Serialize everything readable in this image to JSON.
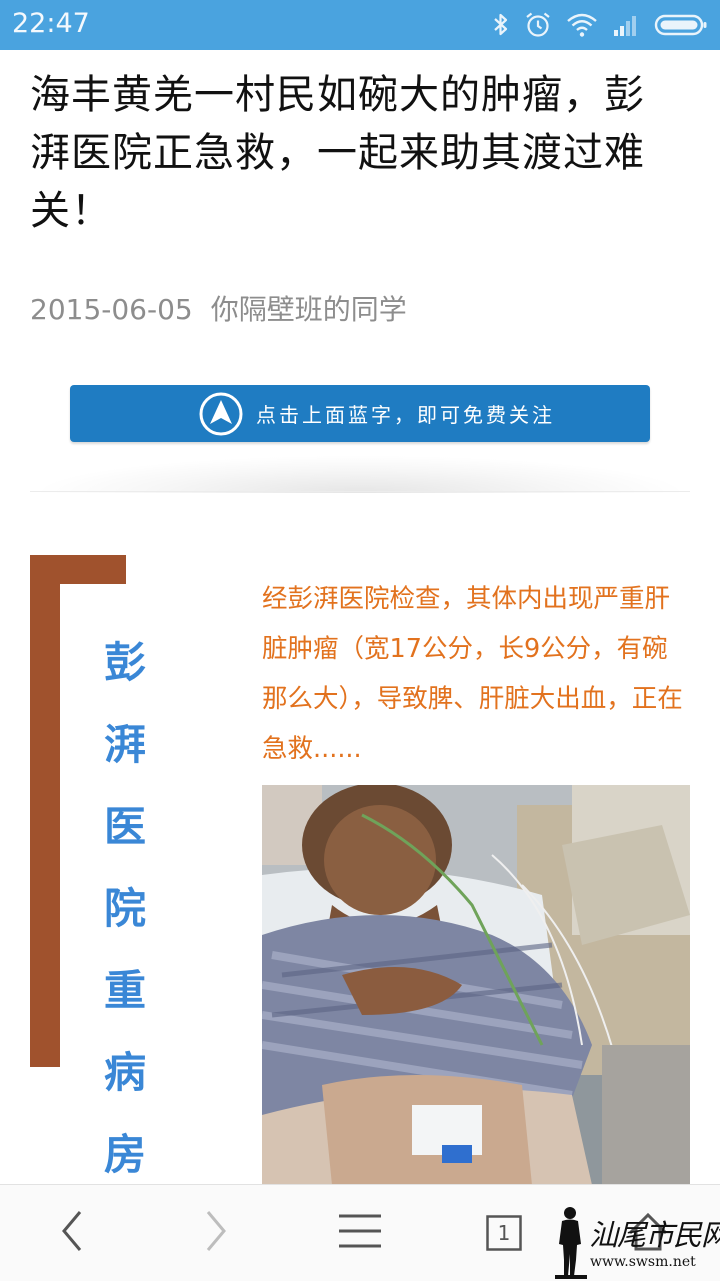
{
  "status_bar": {
    "time": "22:47",
    "icons": [
      "bluetooth-icon",
      "alarm-icon",
      "wifi-icon",
      "signal-icon",
      "battery-icon"
    ],
    "background": "#4aa3df"
  },
  "article": {
    "title": "海丰黄羌一村民如碗大的肿瘤，彭湃医院正急救，一起来助其渡过难关！",
    "date": "2015-06-05",
    "author": "你隔壁班的同学"
  },
  "follow_banner": {
    "text": "点击上面蓝字，即可免费关注",
    "icon": "arrow-up-circle-icon",
    "color": "#1f7cc2"
  },
  "section": {
    "vertical_title_chars": [
      "彭",
      "湃",
      "医",
      "院",
      "重",
      "病",
      "房"
    ],
    "bracket_color": "#a0522d",
    "title_color": "#3a87d6",
    "body_text": "经彭湃医院检查，其体内出现严重肝脏肿瘤（宽17公分，长9公分，有碗那么大），导致脾、肝脏大出血，正在急救......",
    "body_color": "#e2721e"
  },
  "bottom_nav": {
    "buttons": [
      "back-icon",
      "forward-icon",
      "menu-icon",
      "tabs-icon",
      "home-icon"
    ],
    "tabs_count": "1"
  },
  "watermark": {
    "name": "汕尾市民网",
    "url": "www.swsm.net"
  }
}
